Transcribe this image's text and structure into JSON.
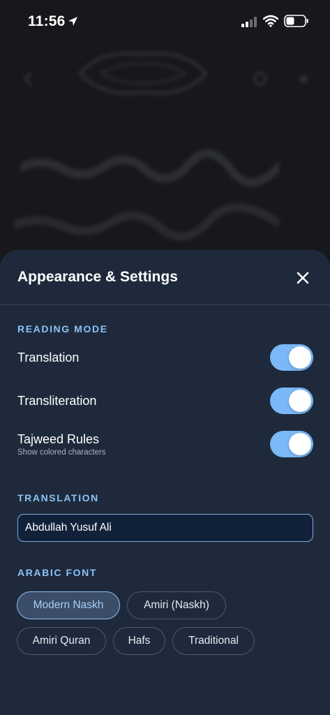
{
  "status_bar": {
    "time": "11:56"
  },
  "sheet": {
    "title": "Appearance & Settings"
  },
  "reading_mode": {
    "section_label": "READING MODE",
    "toggles": [
      {
        "label": "Translation",
        "subtitle": "",
        "enabled": true
      },
      {
        "label": "Transliteration",
        "subtitle": "",
        "enabled": true
      },
      {
        "label": "Tajweed Rules",
        "subtitle": "Show colored characters",
        "enabled": true
      }
    ]
  },
  "translation": {
    "section_label": "TRANSLATION",
    "selected_value": "Abdullah Yusuf Ali"
  },
  "arabic_font": {
    "section_label": "ARABIC FONT",
    "options": [
      {
        "label": "Modern Naskh",
        "selected": true
      },
      {
        "label": "Amiri (Naskh)",
        "selected": false
      },
      {
        "label": "Amiri Quran",
        "selected": false
      },
      {
        "label": "Hafs",
        "selected": false
      },
      {
        "label": "Traditional",
        "selected": false
      }
    ]
  },
  "colors": {
    "accent": "#8cc2f5",
    "toggle_on": "#7ab8f7",
    "sheet_bg": "#1e2a3c"
  }
}
